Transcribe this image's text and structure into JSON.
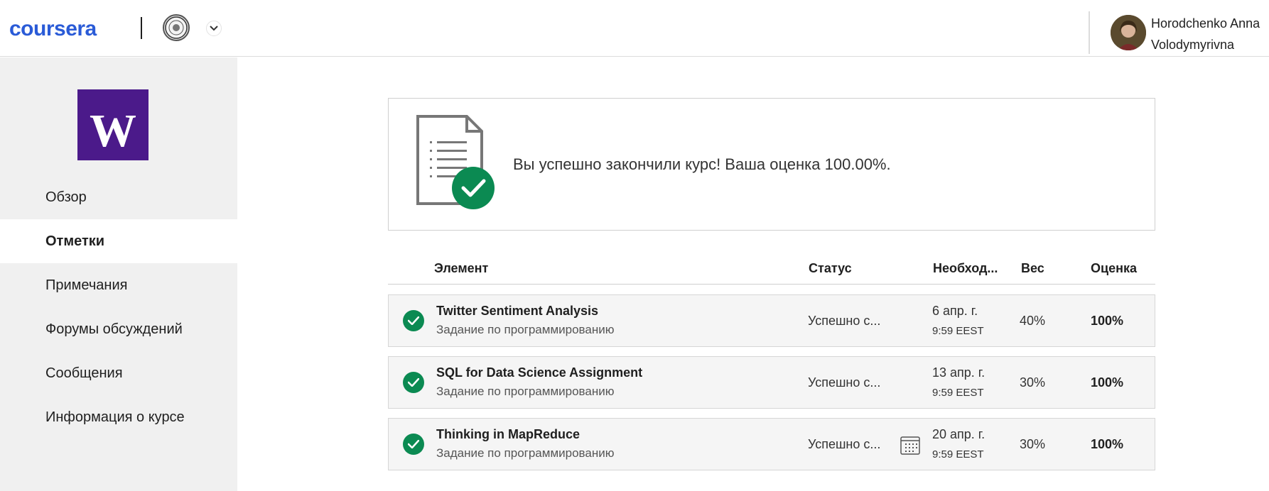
{
  "header": {
    "brand": "coursera",
    "user_name_line1": "Horodchenko Anna",
    "user_name_line2": "Volodymyrivna"
  },
  "sidebar": {
    "logo_letter": "W",
    "items": [
      {
        "label": "Обзор",
        "active": false
      },
      {
        "label": "Отметки",
        "active": true
      },
      {
        "label": "Примечания",
        "active": false
      },
      {
        "label": "Форумы обсуждений",
        "active": false
      },
      {
        "label": "Сообщения",
        "active": false
      },
      {
        "label": "Информация о курсе",
        "active": false
      }
    ]
  },
  "completion": {
    "message": "Вы успешно закончили курс! Ваша оценка 100.00%."
  },
  "table": {
    "columns": {
      "element": "Элемент",
      "status": "Статус",
      "due": "Необход...",
      "weight": "Вес",
      "grade": "Оценка"
    },
    "rows": [
      {
        "title": "Twitter Sentiment Analysis",
        "type": "Задание по программированию",
        "status": "Успешно с...",
        "due_date": "6 апр. г.",
        "due_time": "9:59 EEST",
        "weight": "40%",
        "grade": "100%",
        "calendar_icon": false
      },
      {
        "title": "SQL for Data Science Assignment",
        "type": "Задание по программированию",
        "status": "Успешно с...",
        "due_date": "13 апр. г.",
        "due_time": "9:59 EEST",
        "weight": "30%",
        "grade": "100%",
        "calendar_icon": false
      },
      {
        "title": "Thinking in MapReduce",
        "type": "Задание по программированию",
        "status": "Успешно с...",
        "due_date": "20 апр. г.",
        "due_time": "9:59 EEST",
        "weight": "30%",
        "grade": "100%",
        "calendar_icon": true
      }
    ]
  },
  "colors": {
    "brand_blue": "#2a5bd7",
    "uw_purple": "#4b1a8a",
    "success_green": "#0b8a52"
  }
}
